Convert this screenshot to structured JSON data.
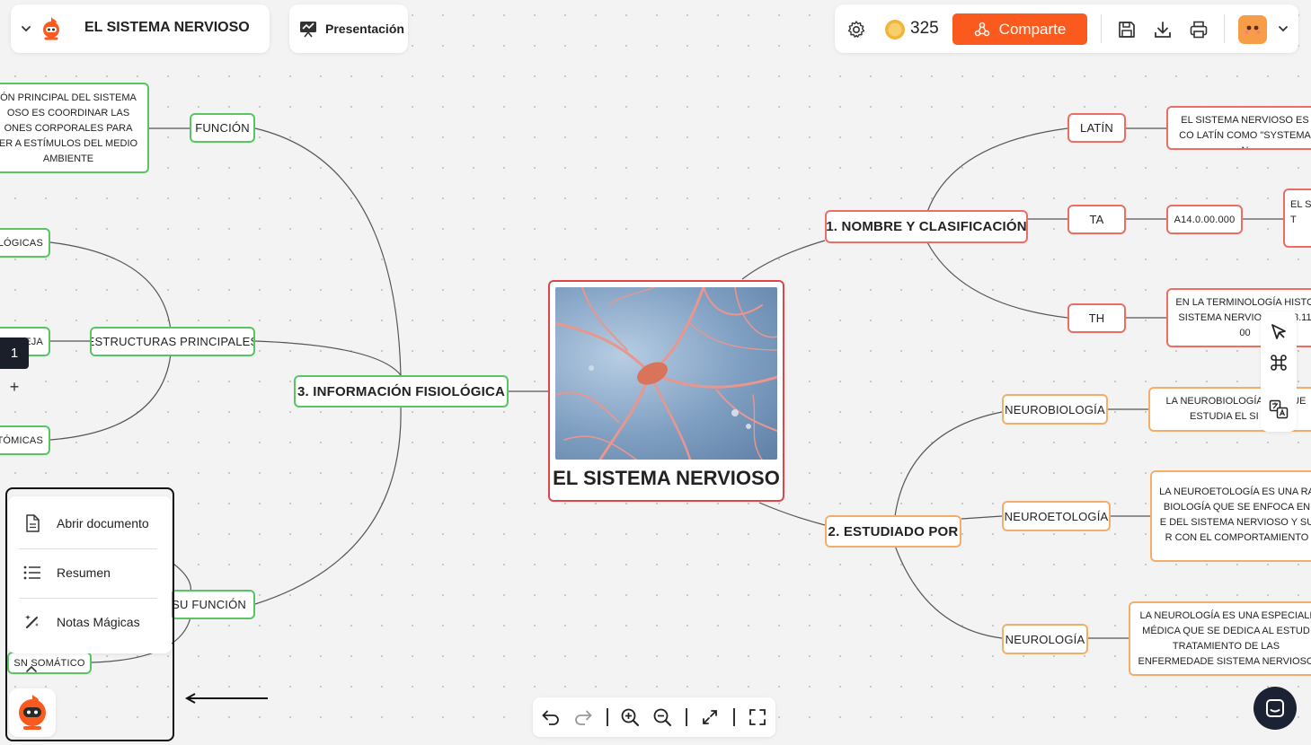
{
  "header": {
    "doc_title": "EL SISTEMA NERVIOSO",
    "presentation_label": "Presentación",
    "coins": "325",
    "share_label": "Comparte"
  },
  "mindmap": {
    "center_title": "EL SISTEMA NERVIOSO",
    "branch_1": "1. NOMBRE Y CLASIFICACIÓN",
    "branch_2": "2. ESTUDIADO POR",
    "branch_3": "3. INFORMACIÓN FISIOLÓGICA",
    "latin": "LATÍN",
    "latin_text": "EL SISTEMA NERVIOSO ES CO LATÍN COMO \"SYSTEMA N",
    "ta": "TA",
    "ta_code": "A14.0.00.000",
    "ta_text": "EL SI T",
    "th": "TH",
    "th_text": "EN LA TERMINOLOGÍA HISTO SISTEMA NERVIO LAS H3.11 00",
    "neurobiologia": "NEUROBIOLOGÍA",
    "neurobiologia_text": "LA NEUROBIOLOGÍA DIS QUE ESTUDIA EL SI NER",
    "neuroetologia": "NEUROETOLOGÍA",
    "neuroetologia_text": "LA NEUROETOLOGÍA ES UNA RA BIOLOGÍA QUE SE ENFOCA EN E DEL SISTEMA NERVIOSO Y SU R CON EL COMPORTAMIENTO",
    "neurologia": "NEUROLOGÍA",
    "neurologia_text": "LA NEUROLOGÍA ES UNA ESPECIALI MÉDICA QUE SE DEDICA AL ESTUD TRATAMIENTO DE LAS ENFERMEDADE SISTEMA NERVIOSO",
    "funcion": "FUNCIÓN",
    "funcion_text": "ÓN PRINCIPAL DEL SISTEMA OSO ES COORDINAR LAS ONES CORPORALES PARA ER A ESTÍMULOS DEL MEDIO AMBIENTE",
    "logicas": "LÓGICAS",
    "estructuras": "ESTRUCTURAS PRINCIPALES",
    "eja": "EJA",
    "tomicas": "TÓMICAS",
    "su_funcion": "SU FUNCIÓN",
    "sn_somatico": "SN SOMÁTICO"
  },
  "page_panel": {
    "page_number": "1",
    "add_label": "+"
  },
  "context_menu": {
    "items": [
      {
        "label": "Abrir documento",
        "icon": "document-icon"
      },
      {
        "label": "Resumen",
        "icon": "list-icon"
      },
      {
        "label": "Notas Mágicas",
        "icon": "magic-wand-icon"
      }
    ]
  },
  "colors": {
    "accent_orange": "#fa5a1e",
    "branch_red": "#ee6d63",
    "branch_green": "#58c464",
    "branch_orange": "#f5ad6a"
  }
}
